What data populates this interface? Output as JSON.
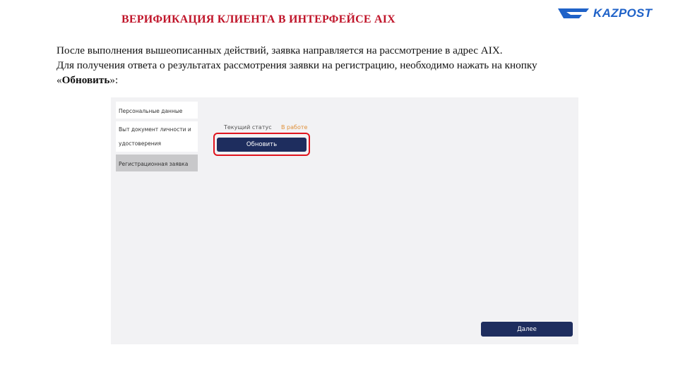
{
  "slide": {
    "title": "ВЕРИФИКАЦИЯ КЛИЕНТА В ИНТЕРФЕЙСЕ AIX",
    "logo_text": "KAZPOST",
    "line1": "После выполнения вышеописанных действий, заявка направляется на рассмотрение в адрес AIX.",
    "line2": "Для получения ответа о результатах рассмотрения заявки на регистрацию, необходимо нажать на кнопку",
    "line3_open": "«",
    "line3_bold": "Обновить",
    "line3_close": "»:"
  },
  "colors": {
    "title": "#c0152a",
    "logo": "#1f62c8",
    "button": "#1e2d5e",
    "status_value": "#e0913a",
    "highlight": "#e0141e"
  },
  "app": {
    "sidebar": {
      "items": [
        {
          "label": "Персональные данные"
        },
        {
          "label_line1": "Выт документ личности и",
          "label_line2": "удостоверения"
        },
        {
          "label": "Регистрационная заявка"
        }
      ]
    },
    "status": {
      "label": "Текущий статус",
      "value": "В работе"
    },
    "refresh_button": "Обновить",
    "next_button": "Далее"
  }
}
